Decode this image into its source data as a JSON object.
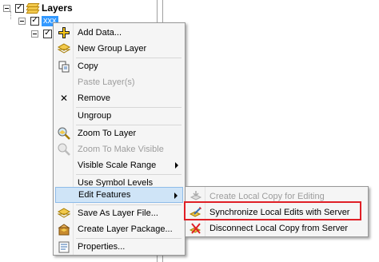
{
  "tree": {
    "root_label": "Layers",
    "child_label": "xxx",
    "checkbox_mark": "✓"
  },
  "menu": {
    "items": [
      {
        "label": "Add Data...",
        "icon": "add-data-icon",
        "enabled": true
      },
      {
        "label": "New Group Layer",
        "icon": "group-layer-icon",
        "enabled": true
      },
      {
        "label": "Copy",
        "icon": "copy-icon",
        "enabled": true
      },
      {
        "label": "Paste Layer(s)",
        "icon": "",
        "enabled": false
      },
      {
        "label": "Remove",
        "icon": "remove-icon",
        "enabled": true
      },
      {
        "label": "Ungroup",
        "icon": "",
        "enabled": true
      },
      {
        "label": "Zoom To Layer",
        "icon": "zoom-to-layer-icon",
        "enabled": true
      },
      {
        "label": "Zoom To Make Visible",
        "icon": "zoom-visible-icon",
        "enabled": false
      },
      {
        "label": "Visible Scale Range",
        "icon": "",
        "enabled": true,
        "submenu": true
      },
      {
        "label": "Use Symbol Levels",
        "icon": "",
        "enabled": true
      },
      {
        "label": "Edit Features",
        "icon": "",
        "enabled": true,
        "submenu": true,
        "highlighted": true
      },
      {
        "label": "Save As Layer File...",
        "icon": "save-layer-icon",
        "enabled": true
      },
      {
        "label": "Create Layer Package...",
        "icon": "layer-package-icon",
        "enabled": true
      },
      {
        "label": "Properties...",
        "icon": "properties-icon",
        "enabled": true
      }
    ],
    "remove_glyph": "✕"
  },
  "submenu": {
    "items": [
      {
        "label": "Create Local Copy for Editing",
        "icon": "local-copy-icon",
        "enabled": false
      },
      {
        "label": "Synchronize Local Edits with Server",
        "icon": "sync-edits-icon",
        "enabled": true,
        "outlined": true
      },
      {
        "label": "Disconnect Local Copy from Server",
        "icon": "disconnect-icon",
        "enabled": true
      }
    ]
  },
  "colors": {
    "highlight_bg": "#cfe4f7",
    "selection_bg": "#3399ff",
    "outline_red": "#e01f26"
  }
}
